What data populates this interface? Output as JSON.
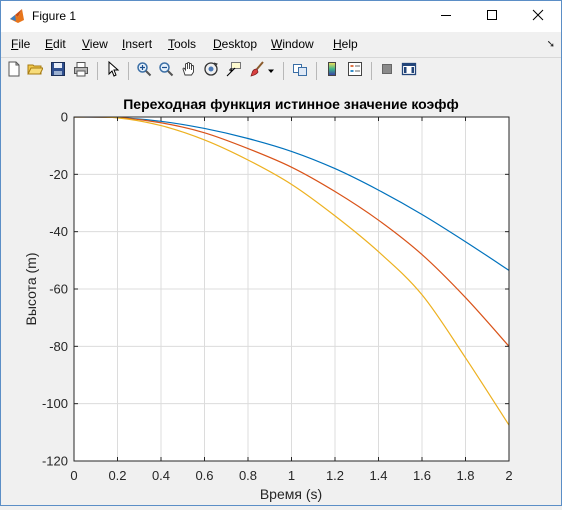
{
  "window": {
    "title": "Figure 1",
    "controls": [
      "minimize",
      "maximize",
      "close"
    ]
  },
  "menu": {
    "items": [
      {
        "label": "File",
        "accel": "F",
        "rest": "ile"
      },
      {
        "label": "Edit",
        "accel": "E",
        "rest": "dit"
      },
      {
        "label": "View",
        "accel": "V",
        "rest": "iew"
      },
      {
        "label": "Insert",
        "accel": "I",
        "rest": "nsert"
      },
      {
        "label": "Tools",
        "accel": "T",
        "rest": "ools"
      },
      {
        "label": "Desktop",
        "accel": "D",
        "rest": "esktop"
      },
      {
        "label": "Window",
        "accel": "W",
        "rest": "indow"
      },
      {
        "label": "Help",
        "accel": "H",
        "rest": "elp"
      }
    ]
  },
  "toolbar": {
    "icons": [
      "new-figure-icon",
      "open-file-icon",
      "save-icon",
      "print-icon",
      "edit-plot-arrow-icon",
      "zoom-in-icon",
      "zoom-out-icon",
      "pan-hand-icon",
      "rotate-3d-icon",
      "data-cursor-icon",
      "brush-icon",
      "brush-dropdown-icon",
      "link-plot-icon",
      "colorbar-icon",
      "legend-icon",
      "hide-plot-tools-icon",
      "show-plot-tools-icon"
    ]
  },
  "colors": {
    "series1": "#0072bd",
    "series2": "#d95319",
    "series3": "#edb120",
    "grid": "#dcdcdc",
    "axes": "#262626"
  },
  "chart_data": {
    "type": "line",
    "title": "Переходная функция истинное значение коэфф",
    "xlabel": "Время (s)",
    "ylabel": "Высота (m)",
    "xlim": [
      0,
      2
    ],
    "ylim": [
      -120,
      0
    ],
    "xticks": [
      "0",
      "0.2",
      "0.4",
      "0.6",
      "0.8",
      "1",
      "1.2",
      "1.4",
      "1.6",
      "1.8",
      "2"
    ],
    "yticks": [
      "0",
      "-20",
      "-40",
      "-60",
      "-80",
      "-100",
      "-120"
    ],
    "grid": true,
    "legend": "none",
    "series": [
      {
        "color": "#0072bd",
        "x": [
          0,
          0.2,
          0.4,
          0.6,
          0.8,
          1.0,
          1.2,
          1.4,
          1.6,
          1.8,
          2.0
        ],
        "y": [
          0,
          -0.2,
          -1.5,
          -4.0,
          -7.5,
          -12.0,
          -18.0,
          -25.5,
          -34.0,
          -43.5,
          -53.5
        ]
      },
      {
        "color": "#d95319",
        "x": [
          0,
          0.2,
          0.4,
          0.6,
          0.8,
          1.0,
          1.2,
          1.4,
          1.6,
          1.8,
          2.0
        ],
        "y": [
          0,
          -0.2,
          -2.0,
          -5.5,
          -11.0,
          -17.5,
          -26.0,
          -36.0,
          -48.0,
          -63.0,
          -80.0
        ]
      },
      {
        "color": "#edb120",
        "x": [
          0,
          0.2,
          0.4,
          0.6,
          0.8,
          1.0,
          1.2,
          1.4,
          1.6,
          1.8,
          2.0
        ],
        "y": [
          0,
          -0.3,
          -3.0,
          -8.0,
          -15.0,
          -23.5,
          -34.5,
          -47.0,
          -62.0,
          -84.0,
          -107.5
        ]
      }
    ]
  }
}
